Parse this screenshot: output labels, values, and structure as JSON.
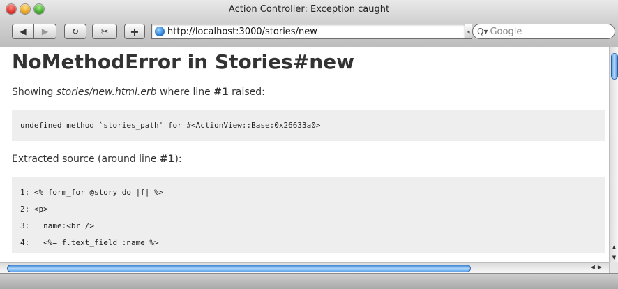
{
  "window": {
    "title": "Action Controller: Exception caught"
  },
  "toolbar": {
    "back_icon": "◀",
    "forward_icon": "▶",
    "reload_icon": "↻",
    "snip_icon": "✂",
    "add_icon": "+",
    "url": "http://localhost:3000/stories/new",
    "search_placeholder": "Google"
  },
  "page": {
    "heading": "NoMethodError in Stories#new",
    "showing_prefix": "Showing ",
    "template_file": "stories/new.html.erb",
    "showing_middle": " where line ",
    "line_number": "#1",
    "showing_suffix": " raised:",
    "error_message": "undefined method `stories_path' for #<ActionView::Base:0x26633a0>",
    "extracted_prefix": "Extracted source (around line ",
    "extracted_line": "#1",
    "extracted_suffix": "):",
    "source_lines": [
      "1: <% form_for @story do |f| %>",
      "2: <p>",
      "3:   name:<br />",
      "4:   <%= f.text_field :name %>"
    ]
  },
  "colors": {
    "heading": "#333333",
    "code_background": "#eeeeee",
    "scroll_thumb": "#5aa0e8"
  }
}
